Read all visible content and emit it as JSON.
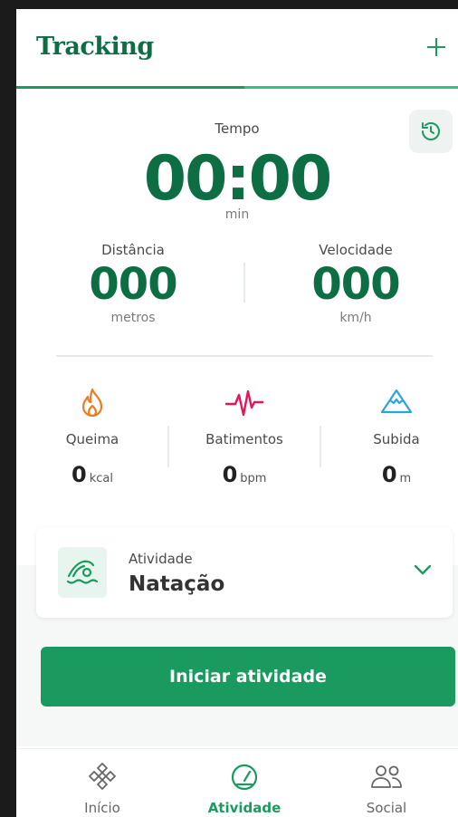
{
  "header": {
    "title": "Tracking",
    "add_icon": "plus-icon"
  },
  "time": {
    "label": "Tempo",
    "value": "00:00",
    "unit": "min",
    "history_icon": "history-icon"
  },
  "distance": {
    "label": "Distância",
    "value": "000",
    "unit": "metros"
  },
  "speed": {
    "label": "Velocidade",
    "value": "000",
    "unit": "km/h"
  },
  "stats": [
    {
      "label": "Queima",
      "value": "0",
      "unit": "kcal",
      "icon": "flame-icon",
      "color": "#f07a1e"
    },
    {
      "label": "Batimentos",
      "value": "0",
      "unit": "bpm",
      "icon": "heartbeat-icon",
      "color": "#e0175a"
    },
    {
      "label": "Subida",
      "value": "0",
      "unit": "m",
      "icon": "mountain-icon",
      "color": "#2aa6d8"
    }
  ],
  "activity": {
    "label": "Atividade",
    "value": "Natação",
    "icon": "swimming-icon"
  },
  "start_button": {
    "label": "Iniciar atividade"
  },
  "nav": [
    {
      "label": "Início",
      "icon": "home-diamond-icon",
      "active": false
    },
    {
      "label": "Atividade",
      "icon": "speedometer-icon",
      "active": true
    },
    {
      "label": "Social",
      "icon": "people-icon",
      "active": false
    }
  ],
  "colors": {
    "brand": "#0d6e43",
    "accent": "#1b9a5f"
  }
}
